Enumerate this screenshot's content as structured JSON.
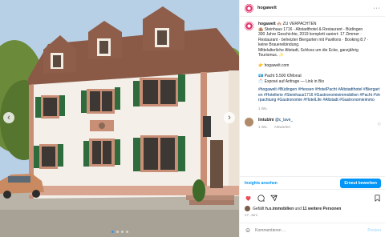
{
  "header": {
    "username": "hogawelt",
    "more_label": "···"
  },
  "caption": {
    "username": "hogawelt",
    "lines": [
      "🏘️ ZU VERPACHTEN",
      "🏨 Steinhaus 1716 - Altstadthotel & Restaurant - Büdingen",
      "300 Jahre Geschichte, 2019 komplett saniert: 17 Zimmer ·",
      "Restaurant · beheizter Biergarten mit Pavillons · Booking 8,7 ·",
      "keine Brauereibindung.",
      "Mittelalterliche Altstadt, Schloss um die Ecke, ganzjährig",
      "Tourismus. ✨",
      "",
      "👉 hogawelt.com",
      "",
      "💶 Pacht 5.500 €/Monat",
      "📩 Exposé auf Anfrage — Link in Bio"
    ],
    "hashtags": "#hogawelt #Büdingen #Hessen #HotelPacht #Altstadthotel #Biergarten #Hotellerie #Steinhaus1716 #Gastronomieimmobilien #Pacht #Verpachtung #Gastronomie #HotelLife #Altstadt #Gastronomieimmo",
    "time": "1 Wo."
  },
  "comment": {
    "username": "lintublni",
    "text": "@c_lave_",
    "time": "1 Wo.",
    "reply_label": "Antworten"
  },
  "insights": {
    "link_label": "Insights ansehen",
    "boost_label": "Erneut bewerben"
  },
  "likes": {
    "prefix": "Gefällt ",
    "user": "h.o.immobilien",
    "middle": " und ",
    "others": "11 weitere Personen"
  },
  "date": "17. Juni",
  "add_comment": {
    "placeholder": "Kommentieren ...",
    "post_label": "Posten"
  },
  "photo": {
    "alt": "Steinhaus 1716 Altstadthotel Büdingen",
    "slides": 4,
    "active_slide": 1
  },
  "colors": {
    "accent": "#0095f6",
    "shutters": "#2e6b3d",
    "roof": "#8a5a47",
    "facade": "#f4efe8"
  }
}
